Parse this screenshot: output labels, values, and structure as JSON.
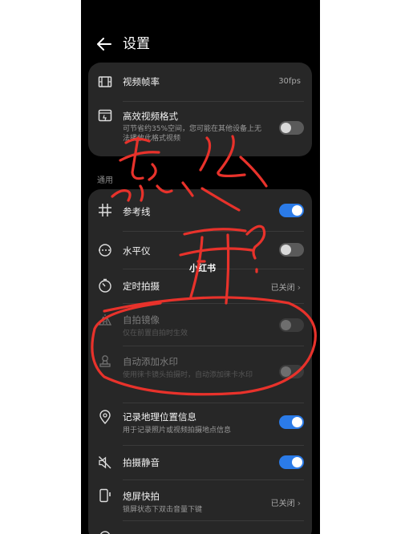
{
  "header": {
    "title": "设置"
  },
  "card1": {
    "frame_rate": {
      "label": "视频帧率",
      "value": "30fps"
    },
    "efficient_format": {
      "label": "高效视频格式",
      "sub": "可节省约35%空间，您可能在其他设备上无法播放此格式视频",
      "toggle": "off"
    }
  },
  "section": {
    "general": "通用"
  },
  "card2": {
    "grid": {
      "label": "参考线",
      "toggle": "on"
    },
    "level": {
      "label": "水平仪",
      "toggle": "off"
    },
    "timer": {
      "label": "定时拍摄",
      "value": "已关闭"
    },
    "mirror": {
      "label": "自拍镜像",
      "sub": "仅在前置自拍时生效",
      "toggle": "off"
    },
    "watermark": {
      "label": "自动添加水印",
      "sub": "使用徕卡镜头拍摄时，自动添加徕卡水印",
      "toggle": "off"
    },
    "location": {
      "label": "记录地理位置信息",
      "sub": "用于记录照片或视频拍摄地点信息",
      "toggle": "on"
    },
    "mute": {
      "label": "拍摄静音",
      "toggle": "on"
    },
    "snapshot": {
      "label": "熄屏快拍",
      "sub": "锁屏状态下双击音量下键",
      "value": "已关闭"
    }
  },
  "overlay": {
    "watermark_text": "小红书"
  },
  "colors": {
    "accent": "#2b7be8",
    "card": "#272727",
    "ink": "#e8322b"
  }
}
